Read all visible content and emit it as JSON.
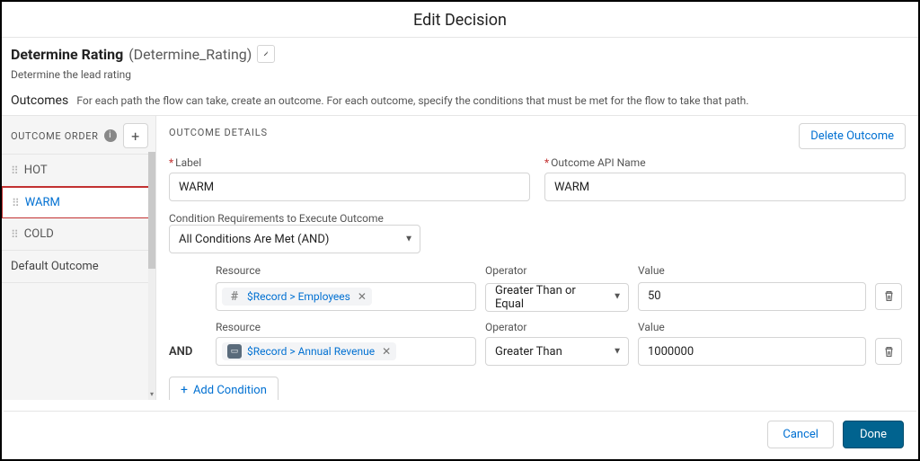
{
  "header": {
    "title": "Edit Decision",
    "decision_label": "Determine Rating",
    "decision_api": "(Determine_Rating)",
    "decision_desc": "Determine the lead rating",
    "outcomes_title": "Outcomes",
    "outcomes_hint": "For each path the flow can take, create an outcome. For each outcome, specify the conditions that must be met for the flow to take that path."
  },
  "left": {
    "title": "OUTCOME ORDER",
    "items": [
      "HOT",
      "WARM",
      "COLD"
    ],
    "default_label": "Default Outcome",
    "selected_index": 1
  },
  "details": {
    "title": "OUTCOME DETAILS",
    "delete_btn": "Delete Outcome",
    "label_field_label": "Label",
    "label_value": "WARM",
    "api_field_label": "Outcome API Name",
    "api_value": "WARM",
    "cond_req_label": "Condition Requirements to Execute Outcome",
    "cond_req_value": "All Conditions Are Met (AND)",
    "col_resource": "Resource",
    "col_operator": "Operator",
    "col_value": "Value",
    "and_label": "AND",
    "rows": [
      {
        "resource": "$Record > Employees",
        "operator": "Greater Than or Equal",
        "value": "50"
      },
      {
        "resource": "$Record > Annual Revenue",
        "operator": "Greater Than",
        "value": "1000000"
      }
    ],
    "add_condition": "Add Condition"
  },
  "footer": {
    "cancel": "Cancel",
    "done": "Done"
  }
}
